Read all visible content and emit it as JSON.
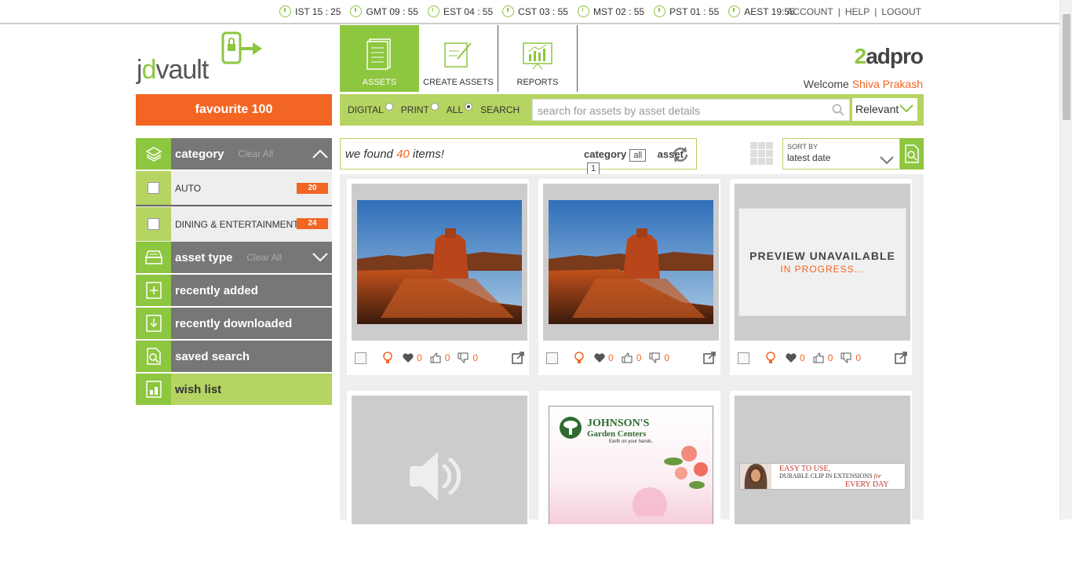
{
  "clocks": [
    {
      "label": "IST 15 : 25"
    },
    {
      "label": "GMT 09 : 55"
    },
    {
      "label": "EST 04 : 55"
    },
    {
      "label": "CST 03 : 55"
    },
    {
      "label": "MST 02 : 55"
    },
    {
      "label": "PST 01 : 55"
    },
    {
      "label": "AEST 19:55"
    }
  ],
  "account": {
    "account": "ACCOUNT",
    "help": "HELP",
    "logout": "LOGOUT",
    "sep": "|"
  },
  "logo": {
    "text_a": "j",
    "text_b": "d",
    "text_c": "vault"
  },
  "nav": {
    "assets": "ASSETS",
    "create": "CREATE ASSETS",
    "reports": "REPORTS"
  },
  "brand": {
    "a": "2",
    "b": "adpro"
  },
  "welcome": {
    "prefix": "Welcome",
    "user": "Shiva Prakash"
  },
  "favourite": "favourite 100",
  "search": {
    "digital": "DIGITAL",
    "print": "PRINT",
    "all": "ALL",
    "search": "SEARCH",
    "placeholder": "search for assets by asset details",
    "relevance": "Relevant"
  },
  "sidebar": {
    "category": "category",
    "category_clear": "Clear All",
    "items": [
      {
        "label": "AUTO",
        "count": "20"
      },
      {
        "label": "DINING & ENTERTAINMENT",
        "count": "24"
      }
    ],
    "asset_type": "asset type",
    "asset_type_clear": "Clear All",
    "recently_added": "recently added",
    "recently_downloaded": "recently downloaded",
    "saved_search": "saved search",
    "wish_list": "wish list"
  },
  "results": {
    "prefix": "we found",
    "count": "40",
    "suffix": "items!",
    "category": "category",
    "category_tag": "all",
    "asset": "asset",
    "asset_tag": "1"
  },
  "sort": {
    "label": "SORT BY",
    "value": "latest date"
  },
  "cards": [
    {
      "likes": "0",
      "thumbs_up": "0",
      "thumbs_down": "0"
    },
    {
      "likes": "0",
      "thumbs_up": "0",
      "thumbs_down": "0"
    },
    {
      "likes": "0",
      "thumbs_up": "0",
      "thumbs_down": "0",
      "preview_title": "PREVIEW UNAVAILABLE",
      "preview_status": "IN PROGRESS..."
    }
  ],
  "ads": {
    "johnson_title": "JOHNSON'S",
    "johnson_sub": "Garden Centers",
    "johnson_tag": "Earth on your hands.",
    "clip_l1": "EASY TO USE,",
    "clip_l2": "DURABLE CLIP IN EXTENSIONS",
    "clip_for": "for",
    "clip_l3": "EVERY DAY"
  }
}
